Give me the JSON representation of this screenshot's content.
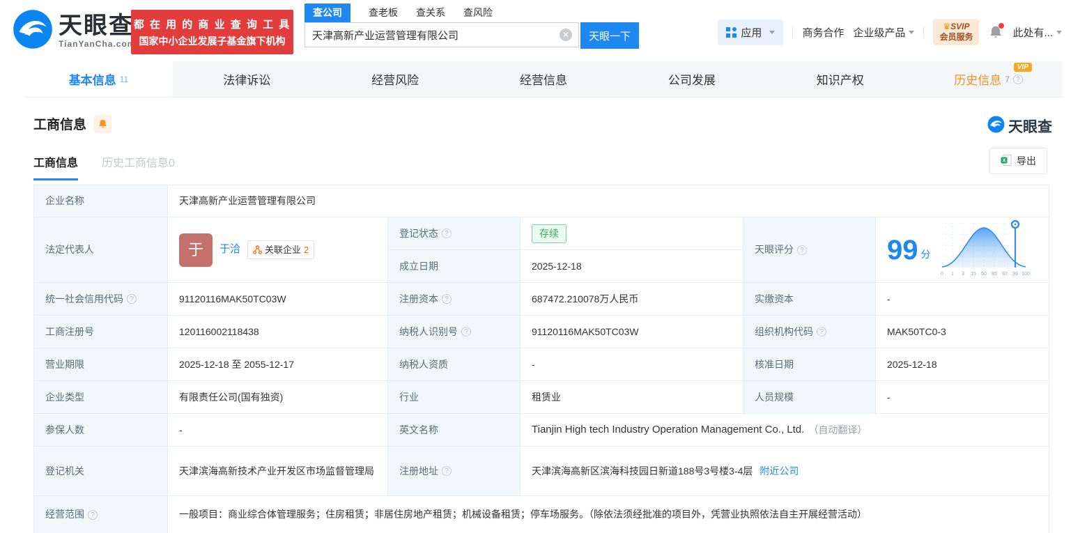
{
  "brand": {
    "name": "天眼查",
    "domain": "TianYanCha.com",
    "slogan_line1": "都 在 用 的 商 业 查 询 工 具",
    "slogan_line2": "国家中小企业发展子基金旗下机构"
  },
  "search": {
    "tabs": [
      {
        "label": "查公司"
      },
      {
        "label": "查老板"
      },
      {
        "label": "查关系"
      },
      {
        "label": "查风险"
      }
    ],
    "value": "天津高新产业运营管理有限公司",
    "clear_glyph": "✕",
    "button": "天眼一下"
  },
  "nav": {
    "apps": "应用",
    "cooperation": "商务合作",
    "enterprise": "企业级产品",
    "svip_crown": "♛",
    "svip_line1": "SVIP",
    "svip_line2": "会员服务",
    "more": "此处有..."
  },
  "tabs": {
    "items": [
      {
        "label": "基本信息",
        "count": "11"
      },
      {
        "label": "法律诉讼"
      },
      {
        "label": "经营风险"
      },
      {
        "label": "经营信息"
      },
      {
        "label": "公司发展"
      },
      {
        "label": "知识产权"
      },
      {
        "label": "历史信息",
        "count": "7",
        "badge": "VIP"
      }
    ]
  },
  "section": {
    "title": "工商信息",
    "subtab_active": "工商信息",
    "subtab_history": "历史工商信息",
    "subtab_history_count": "0",
    "export_label": "导出",
    "watermark": "天眼查"
  },
  "info": {
    "company_name": {
      "label": "企业名称",
      "value": "天津高新产业运营管理有限公司"
    },
    "legal_rep": {
      "label": "法定代表人",
      "avatar": "于",
      "name": "于洽",
      "related_label": "关联企业",
      "related_count": "2"
    },
    "reg_status": {
      "label": "登记状态",
      "value": "存续"
    },
    "establish_date": {
      "label": "成立日期",
      "value": "2025-12-18"
    },
    "score": {
      "label": "天眼评分",
      "value": "99",
      "unit": "分"
    },
    "credit_code": {
      "label": "统一社会信用代码",
      "value": "91120116MAK50TC03W"
    },
    "reg_capital": {
      "label": "注册资本",
      "value": "687472.210078万人民币"
    },
    "paid_capital": {
      "label": "实缴资本",
      "value": "-"
    },
    "reg_number": {
      "label": "工商注册号",
      "value": "120116002118438"
    },
    "taxpayer_id": {
      "label": "纳税人识别号",
      "value": "91120116MAK50TC03W"
    },
    "org_code": {
      "label": "组织机构代码",
      "value": "MAK50TC0-3"
    },
    "business_term": {
      "label": "营业期限",
      "value": "2025-12-18 至 2055-12-17"
    },
    "taxpayer_quality": {
      "label": "纳税人资质",
      "value": "-"
    },
    "approval_date": {
      "label": "核准日期",
      "value": "2025-12-18"
    },
    "company_type": {
      "label": "企业类型",
      "value": "有限责任公司(国有独资)"
    },
    "industry": {
      "label": "行业",
      "value": "租赁业"
    },
    "staff_size": {
      "label": "人员规模",
      "value": "-"
    },
    "insured_count": {
      "label": "参保人数",
      "value": "-"
    },
    "english_name": {
      "label": "英文名称",
      "value": "Tianjin High tech Industry Operation Management Co., Ltd.",
      "note": "（自动翻译）"
    },
    "reg_authority": {
      "label": "登记机关",
      "value": "天津滨海高新技术产业开发区市场监督管理局"
    },
    "reg_address": {
      "label": "注册地址",
      "value": "天津滨海高新区滨海科技园日新道188号3号楼3-4层",
      "link": "附近公司"
    },
    "business_scope": {
      "label": "经营范围",
      "value": "一般项目：商业综合体管理服务；住房租赁；非居住房地产租赁；机械设备租赁；停车场服务。（除依法须经批准的项目外，凭营业执照依法自主开展经营活动）"
    }
  },
  "chart_data": {
    "type": "area",
    "title": "天眼评分分布曲线",
    "x_ticks": [
      "0",
      "1",
      "3",
      "15",
      "50",
      "85",
      "97",
      "99",
      "100"
    ],
    "marker_at": "99",
    "score": 99
  }
}
